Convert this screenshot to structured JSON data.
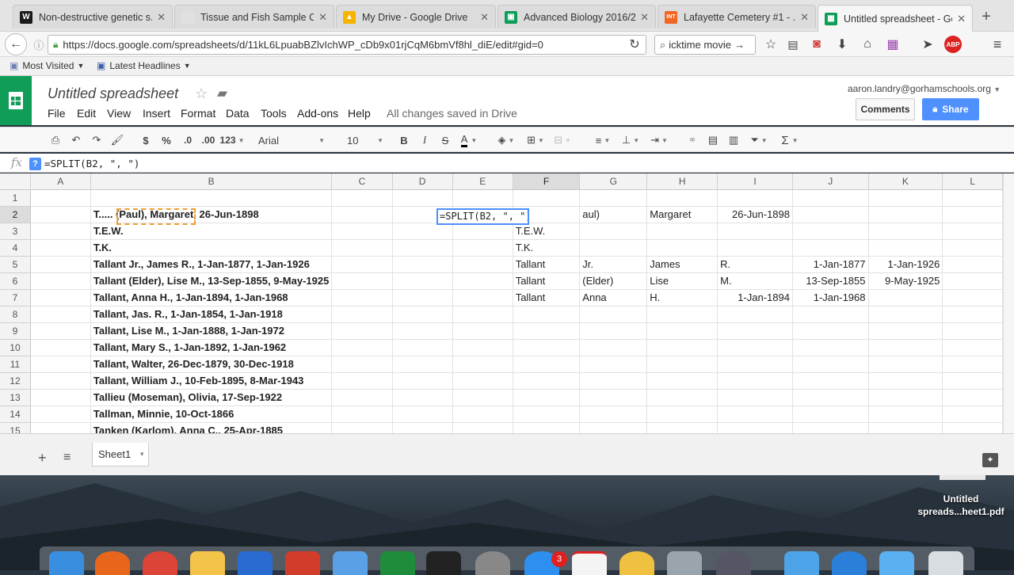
{
  "browser": {
    "tabs": [
      {
        "title": "Non-destructive genetic s...",
        "favicon_color": "#1a1a1a",
        "favicon_glyph": "W"
      },
      {
        "title": "Tissue and Fish Sample Colle...",
        "favicon_color": "#e0e0e0",
        "favicon_glyph": ""
      },
      {
        "title": "My Drive - Google Drive",
        "favicon_color": "#f4b400",
        "favicon_glyph": "▲"
      },
      {
        "title": "Advanced Biology 2016/2...",
        "favicon_color": "#0f9d58",
        "favicon_glyph": "▣"
      },
      {
        "title": "Lafayette Cemetery #1 - ...",
        "favicon_color": "#f26522",
        "favicon_glyph": "INT"
      },
      {
        "title": "Untitled spreadsheet - Go...",
        "favicon_color": "#0f9d58",
        "favicon_glyph": "▦"
      }
    ],
    "url": "https://docs.google.com/spreadsheets/d/11kL6LpuabBZlvIchWP_cDb9x01rjCqM6bmVf8hl_diE/edit#gid=0",
    "search": "icktime movie",
    "bookmarks": [
      "Most Visited",
      "Latest Headlines"
    ]
  },
  "doc": {
    "title": "Untitled spreadsheet",
    "menus": [
      "File",
      "Edit",
      "View",
      "Insert",
      "Format",
      "Data",
      "Tools",
      "Add-ons",
      "Help"
    ],
    "saved_status": "All changes saved in Drive",
    "email": "aaron.landry@gorhamschools.org",
    "comments_label": "Comments",
    "share_label": "Share"
  },
  "toolbar": {
    "currency": "$",
    "percent": "%",
    "dec_less": ".0",
    "dec_more": ".00",
    "more_formats": "123",
    "font": "Arial",
    "font_size": "10",
    "bold": "B",
    "italic": "I",
    "strike": "S",
    "text_color": "A",
    "sum": "Σ"
  },
  "formula_bar": {
    "fx": "fx",
    "help": "?",
    "text": "=SPLIT(B2, \", \")"
  },
  "grid": {
    "columns": [
      "A",
      "B",
      "C",
      "D",
      "E",
      "F",
      "G",
      "H",
      "I",
      "J",
      "K",
      "L"
    ],
    "rows": [
      {
        "n": "1",
        "B": "",
        "F": "",
        "G": "",
        "H": "",
        "I": "",
        "J": "",
        "K": ""
      },
      {
        "n": "2",
        "B": "T..... (Paul), Margaret, 26-Jun-1898",
        "F": "",
        "G": "aul)",
        "H": "Margaret",
        "I": "26-Jun-1898",
        "J": "",
        "K": ""
      },
      {
        "n": "3",
        "B": "T.E.W.",
        "F": "T.E.W.",
        "G": "",
        "H": "",
        "I": "",
        "J": "",
        "K": ""
      },
      {
        "n": "4",
        "B": "T.K.",
        "F": "T.K.",
        "G": "",
        "H": "",
        "I": "",
        "J": "",
        "K": ""
      },
      {
        "n": "5",
        "B": "Tallant Jr., James R., 1-Jan-1877, 1-Jan-1926",
        "F": "Tallant",
        "G": "Jr.",
        "H": "James",
        "I": "R.",
        "J": "1-Jan-1877",
        "K": "1-Jan-1926"
      },
      {
        "n": "6",
        "B": "Tallant (Elder), Lise M., 13-Sep-1855, 9-May-1925",
        "F": "Tallant",
        "G": "(Elder)",
        "H": "Lise",
        "I": "M.",
        "J": "13-Sep-1855",
        "K": "9-May-1925"
      },
      {
        "n": "7",
        "B": "Tallant, Anna H., 1-Jan-1894, 1-Jan-1968",
        "F": "Tallant",
        "G": "Anna",
        "H": "H.",
        "I": "1-Jan-1894",
        "J": "1-Jan-1968",
        "K": ""
      },
      {
        "n": "8",
        "B": "Tallant, Jas. R., 1-Jan-1854, 1-Jan-1918",
        "F": "",
        "G": "",
        "H": "",
        "I": "",
        "J": "",
        "K": ""
      },
      {
        "n": "9",
        "B": "Tallant, Lise M., 1-Jan-1888, 1-Jan-1972",
        "F": "",
        "G": "",
        "H": "",
        "I": "",
        "J": "",
        "K": ""
      },
      {
        "n": "10",
        "B": "Tallant, Mary S., 1-Jan-1892, 1-Jan-1962",
        "F": "",
        "G": "",
        "H": "",
        "I": "",
        "J": "",
        "K": ""
      },
      {
        "n": "11",
        "B": "Tallant, Walter, 26-Dec-1879, 30-Dec-1918",
        "F": "",
        "G": "",
        "H": "",
        "I": "",
        "J": "",
        "K": ""
      },
      {
        "n": "12",
        "B": "Tallant, William J., 10-Feb-1895, 8-Mar-1943",
        "F": "",
        "G": "",
        "H": "",
        "I": "",
        "J": "",
        "K": ""
      },
      {
        "n": "13",
        "B": "Tallieu (Moseman), Olivia, 17-Sep-1922",
        "F": "",
        "G": "",
        "H": "",
        "I": "",
        "J": "",
        "K": ""
      },
      {
        "n": "14",
        "B": "Tallman, Minnie, 10-Oct-1866",
        "F": "",
        "G": "",
        "H": "",
        "I": "",
        "J": "",
        "K": ""
      },
      {
        "n": "15",
        "B": "Tanken (Karlom), Anna C., 25-Apr-1885",
        "F": "",
        "G": "",
        "H": "",
        "I": "",
        "J": "",
        "K": ""
      }
    ],
    "editing_cell_text": "=SPLIT(B2, \", \")"
  },
  "sheets": {
    "active": "Sheet1"
  },
  "desktop": {
    "file_label_line1": "Untitled",
    "file_label_line2": "spreads...heet1.pdf",
    "dock_badge": "3"
  },
  "colors": {
    "sheets_green": "#0f9d58",
    "share_blue": "#4d90fe",
    "copy_dash": "#f0a030"
  }
}
